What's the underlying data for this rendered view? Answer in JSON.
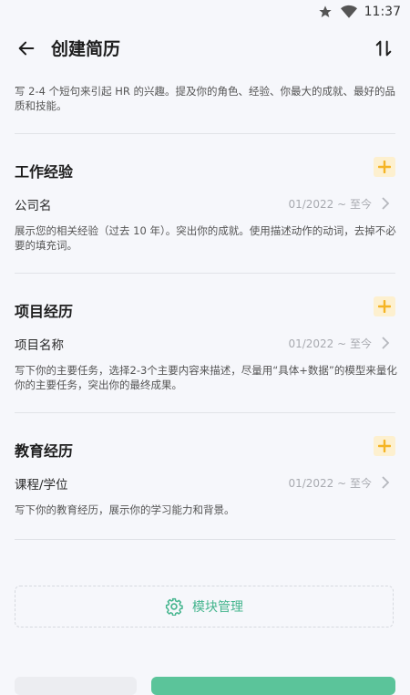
{
  "status_bar": {
    "time": "11:37",
    "icons": [
      "star-icon",
      "wifi-icon"
    ]
  },
  "header": {
    "title": "创建简历",
    "back_icon": "arrow-left-icon",
    "sort_icon": "sort-arrows-icon"
  },
  "summary": {
    "hint": "写 2-4 个短句来引起 HR 的兴趣。提及你的角色、经验、你最大的成就、最好的品质和技能。"
  },
  "sections": {
    "work": {
      "title": "工作经验",
      "field_label": "公司名",
      "date_range": "01/2022 ~ 至今",
      "description": "展示您的相关经验（过去 10 年）。突出你的成就。使用描述动作的动词，去掉不必要的填充词。"
    },
    "project": {
      "title": "项目经历",
      "field_label": "项目名称",
      "date_range": "01/2022 ~ 至今",
      "description": "写下你的主要任务，选择2-3个主要内容来描述，尽量用“具体+数据”的模型来量化你的主要任务，突出你的最终成果。"
    },
    "education": {
      "title": "教育经历",
      "field_label": "课程/学位",
      "date_range": "01/2022 ~ 至今",
      "description": "写下你的教育经历，展示你的学习能力和背景。"
    }
  },
  "module_management": {
    "label": "模块管理",
    "icon": "gear-icon"
  },
  "colors": {
    "accent_green": "#45b58e",
    "add_button_bg": "#fdf0cf",
    "add_button_fg": "#f5b423"
  }
}
